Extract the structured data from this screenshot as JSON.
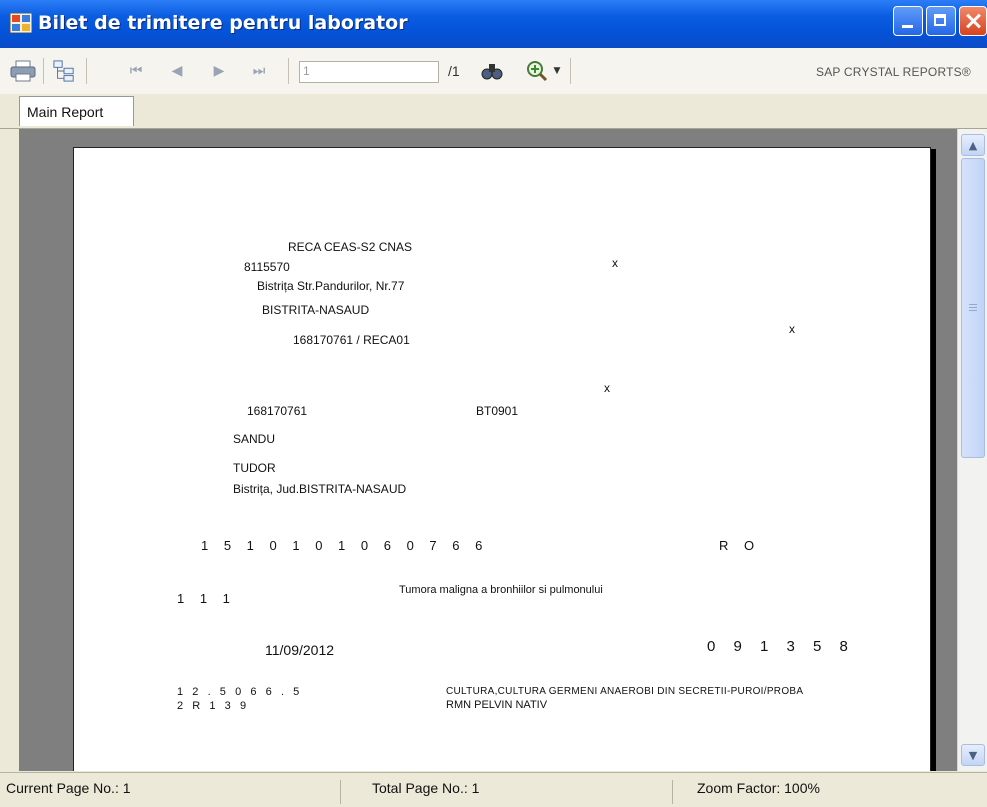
{
  "window": {
    "title": "Bilet de trimitere pentru laborator",
    "icon": "crystal-reports-app-icon",
    "controls": [
      "minimize",
      "maximize",
      "close"
    ]
  },
  "toolbar": {
    "icons": [
      "printer-icon",
      "group-tree-icon",
      "first-page-icon",
      "previous-page-icon",
      "next-page-icon",
      "last-page-icon",
      "find-icon",
      "zoom-icon"
    ],
    "page_input_value": "1",
    "page_total": "/1",
    "brand": "SAP CRYSTAL REPORTS®"
  },
  "tabs": [
    {
      "label": "Main Report"
    }
  ],
  "report": {
    "lines": {
      "provider_name": "RECA CEAS-S2 CNAS",
      "provider_code": "8115570",
      "provider_address": "Bistrița Str.Pandurilor, Nr.77",
      "provider_county": "BISTRITA-NASAUD",
      "contract_code": "168170761 / RECA01",
      "mark_1": "x",
      "mark_2": "x",
      "mark_3": "x",
      "doctor_code": "168170761",
      "doctor_parafa": "BT0901",
      "last_name": "SANDU",
      "first_name": "TUDOR",
      "patient_address": "Bistrița, Jud.BISTRITA-NASAUD",
      "cnp": "1 5 1 0 1 0 1 0 6 0 7 6 6",
      "country": "R O",
      "diagnosis_code": "1 1 1",
      "diagnosis": "Tumora maligna a bronhiilor si pulmonului",
      "date": "11/09/2012",
      "ticket_number": "0 9 1 3 5 8",
      "analysis_code_1": "1   2   .   5   0   6   6   .   5",
      "analysis_name_1": "CULTURA,CULTURA GERMENI ANAEROBI DIN SECRETII-PUROI/PROBA",
      "analysis_code_2": "2   R   1   3   9",
      "analysis_name_2": "RMN PELVIN NATIV"
    }
  },
  "statusbar": {
    "current_page": "Current Page No.: 1",
    "total_page": "Total Page No.: 1",
    "zoom": "Zoom Factor: 100%"
  }
}
